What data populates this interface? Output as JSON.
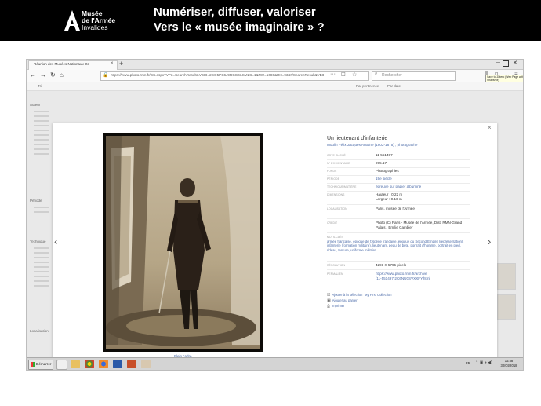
{
  "slide": {
    "logo_line1": "Musée",
    "logo_line2": "de l'Armée",
    "logo_line3": "Invalides",
    "title_line1": "Numériser, diffuser, valoriser",
    "title_line2": "Vers le « musée imaginaire » ?"
  },
  "browser": {
    "tab_title": "Réunion des Musées Nationaux-Gr",
    "tab_close": "×",
    "new_tab": "+",
    "url": "https://www.photo.rmn.fr/CS.aspx?VP3=SearchResult&VBID=2CO5PC6J9RGC0&SMLS=1&RW=1680&RH=934#/SearchResult&VBID=",
    "search_placeholder": "Rechercher",
    "tooltip": "Save to Zotero (Web Page with Snapshot)",
    "nav_back": "←",
    "nav_forward": "→",
    "nav_reload": "↻",
    "nav_home": "⌂",
    "url_more": "···",
    "url_star": "☆",
    "url_pocket": "◫",
    "url_lock": "🔒",
    "search_icon": "⌕",
    "toolbar_library": "⫼",
    "toolbar_sidebar": "▯",
    "toolbar_menu": "≡",
    "window_minimize": "—",
    "window_close": "✕"
  },
  "modal": {
    "close": "×",
    "prev": "‹",
    "next": "›",
    "photo_caption": "Plein cadre",
    "title": "Un lieutenant d'infanterie",
    "author": "Moulin Félix Jacques Antoine (1802-1875) , photographe",
    "fields": [
      {
        "label": "COTE CLICHÉ",
        "value": "11-551497"
      },
      {
        "label": "N° D'INVENTAIRE",
        "value": "995.17"
      },
      {
        "label": "FONDS",
        "value": "Photographies"
      },
      {
        "label": "PÉRIODE",
        "value": "19e siècle",
        "link": true
      },
      {
        "label": "TECHNIQUE/MATIÈRE",
        "value": "épreuve sur papier albuminé",
        "link": true
      },
      {
        "label": "DIMENSIONS",
        "value": "Hauteur : 0.22 m",
        "value2": "Largeur : 0.16 m"
      },
      {
        "label": "LOCALISATION",
        "value": "Paris, musée de l'Armée"
      },
      {
        "label": "CRÉDIT",
        "value": "Photo (C) Paris - Musée de l'Armée, Dist. RMN-Grand",
        "value2": "Palais / Emilie Cambier"
      },
      {
        "label": "RÉSOLUTION",
        "value": "4291 X 5795 pixels"
      },
      {
        "label": "PERMALIEN",
        "value": "https://www.photo.rmn.fr/archive",
        "value2": "/11-551497-2C6NU0SVXXFY.html",
        "link": true
      }
    ],
    "keywords_label": "MOTS-CLÉS",
    "keywords": "armée française, époque de l'Algérie française, époque du Second Empire (représentation), infanterie (formation militaire), lieutenant, peau de bête, portrait d'homme, portrait en pied, rideau, tenture, uniforme militaire",
    "actions": [
      {
        "icon": "☑",
        "label": "Ajouter à la sélection \"My First Collection\""
      },
      {
        "icon": "▣",
        "label": "Ajouter au panier"
      },
      {
        "icon": "⎙",
        "label": "Imprimer"
      }
    ]
  },
  "background_page": {
    "filters": [
      "Tri",
      "Par pertinence",
      "Par date"
    ],
    "sidebar_heads": [
      "Auteur",
      "Période",
      "Technique",
      "Localisation"
    ]
  },
  "taskbar": {
    "start_label": "Démarrer",
    "language": "FR",
    "time": "15:58",
    "date": "30/04/2018",
    "tray": "⌃ ▣ ◑ ◀)"
  }
}
